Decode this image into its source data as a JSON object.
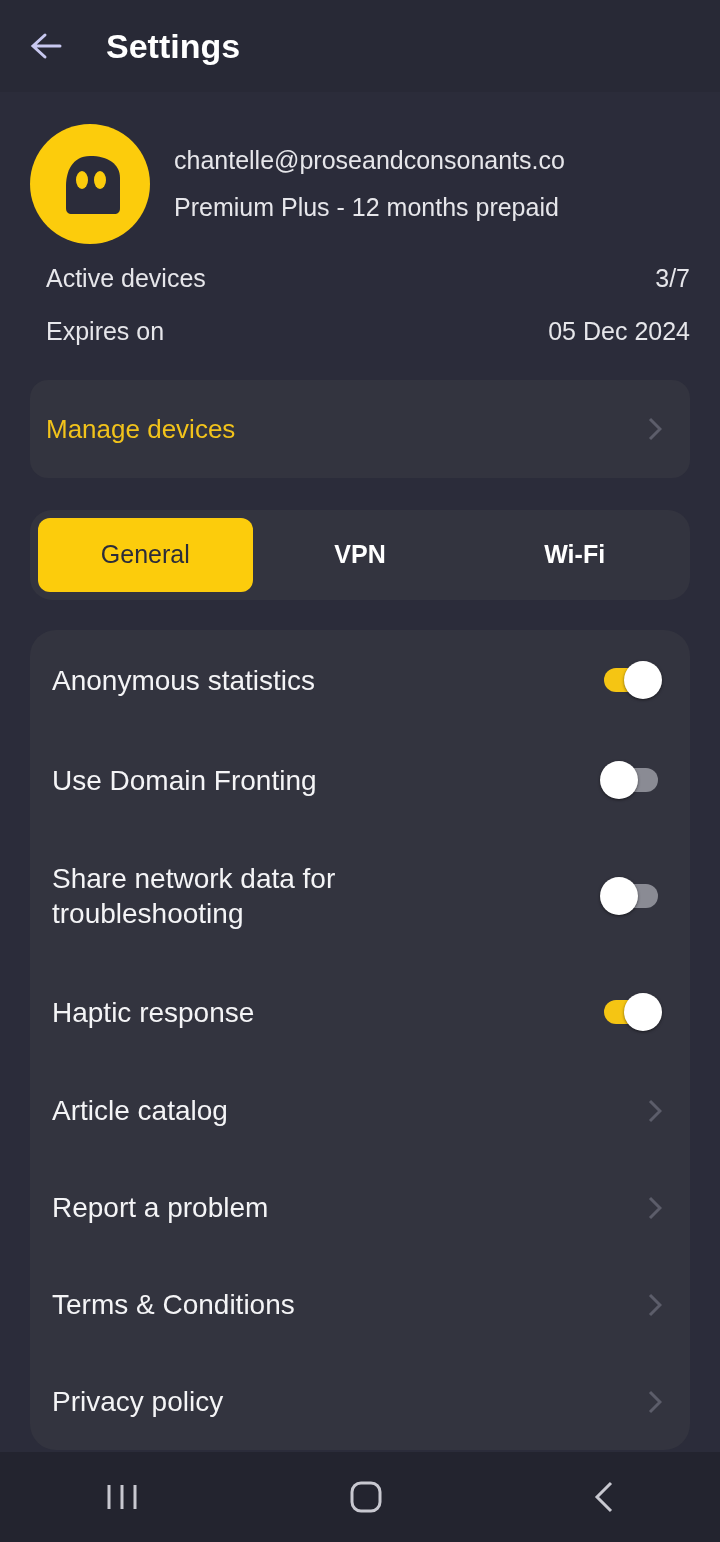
{
  "header": {
    "title": "Settings"
  },
  "account": {
    "email": "chantelle@proseandconsonants.co",
    "plan": "Premium Plus - 12 months prepaid"
  },
  "details": [
    {
      "label": "Active devices",
      "value": "3/7"
    },
    {
      "label": "Expires on",
      "value": "05 Dec 2024"
    }
  ],
  "manage_devices": {
    "label": "Manage devices"
  },
  "tabs": [
    {
      "label": "General",
      "selected": true
    },
    {
      "label": "VPN",
      "selected": false
    },
    {
      "label": "Wi-Fi",
      "selected": false
    }
  ],
  "settings": [
    {
      "kind": "toggle",
      "label": "Anonymous statistics",
      "on": true
    },
    {
      "kind": "toggle",
      "label": "Use Domain Fronting",
      "on": false
    },
    {
      "kind": "toggle",
      "label": "Share network data for troubleshooting",
      "on": false
    },
    {
      "kind": "toggle",
      "label": "Haptic response",
      "on": true
    },
    {
      "kind": "link",
      "label": "Article catalog"
    },
    {
      "kind": "link",
      "label": "Report a problem"
    },
    {
      "kind": "link",
      "label": "Terms & Conditions"
    },
    {
      "kind": "link",
      "label": "Privacy policy"
    }
  ]
}
